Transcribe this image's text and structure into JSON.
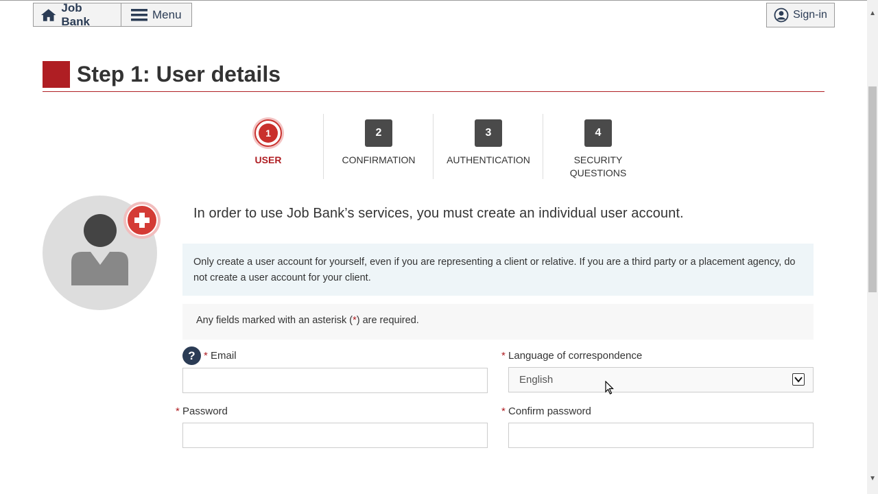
{
  "nav": {
    "home_label": "Job Bank",
    "menu_label": "Menu",
    "signin_label": "Sign-in"
  },
  "page": {
    "title": "Step 1: User details"
  },
  "steps": [
    {
      "number": "1",
      "label": "USER",
      "active": true
    },
    {
      "number": "2",
      "label": "CONFIRMATION",
      "active": false
    },
    {
      "number": "3",
      "label": "AUTHENTICATION",
      "active": false
    },
    {
      "number": "4",
      "label": "SECURITY QUESTIONS",
      "active": false
    }
  ],
  "intro": "In order to use Job Bank’s services, you must create an individual user account.",
  "info_box": "Only create a user account for yourself, even if you are representing a client or relative. If you are a third party or a placement agency, do not create a user account for your client.",
  "required_note": {
    "prefix": "Any fields marked with an asterisk (",
    "marker": "*",
    "suffix": ") are required."
  },
  "form": {
    "asterisk": "*",
    "email": {
      "label": "Email",
      "value": ""
    },
    "language": {
      "label": "Language of correspondence",
      "selected": "English"
    },
    "password": {
      "label": "Password",
      "value": ""
    },
    "confirm_password": {
      "label": "Confirm password",
      "value": ""
    }
  },
  "colors": {
    "brand_red": "#af1e23",
    "nav_blue": "#2b3c55"
  },
  "icons": [
    "home-icon",
    "hamburger-menu-icon",
    "user-circle-icon",
    "user-avatar-icon",
    "plus-icon",
    "help-icon",
    "chevron-down-icon",
    "mouse-cursor-icon"
  ]
}
